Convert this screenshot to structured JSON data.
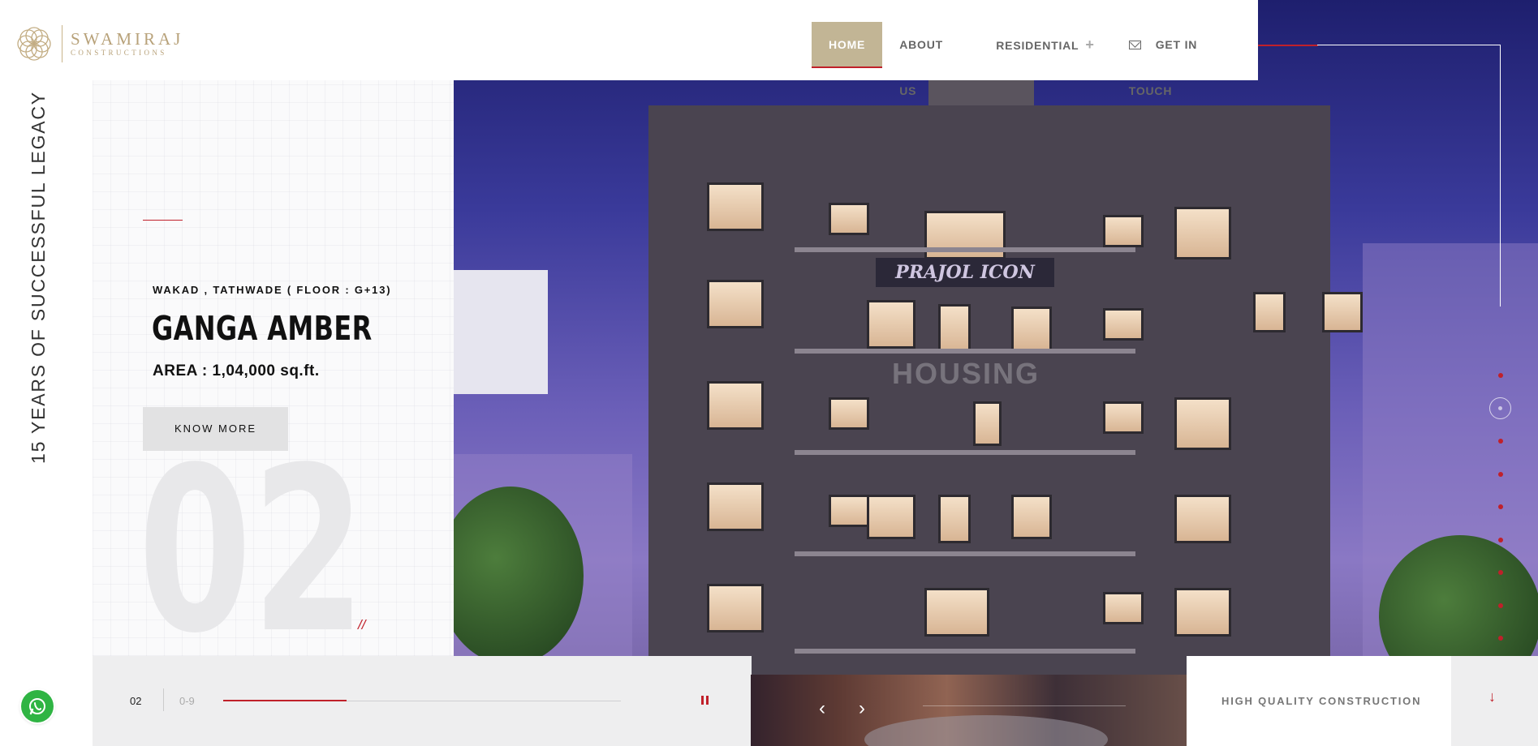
{
  "brand": {
    "name": "SWAMIRAJ",
    "tagline": "CONSTRUCTIONS"
  },
  "nav": {
    "items": [
      {
        "label": "HOME",
        "active": true
      },
      {
        "label": "ABOUT US"
      },
      {
        "label": "RESIDENTIAL"
      },
      {
        "label": "GET IN TOUCH"
      }
    ]
  },
  "side_text": "15 YEARS OF SUCCESSFUL LEGACY",
  "slide": {
    "location": "WAKAD , TATHWADE ( FLOOR : G+13)",
    "title": "GANGA AMBER",
    "area": "AREA : 1,04,000 sq.ft.",
    "cta": "KNOW MORE",
    "number": "02",
    "slashes": "//"
  },
  "hero_image": {
    "sign_text": "PRAJOL ICON",
    "watermark_text": "HOUSING"
  },
  "slider_controls": {
    "current": "02",
    "range": "0-9",
    "progress_fraction": 0.31
  },
  "bottom": {
    "feature_label": "HIGH QUALITY CONSTRUCTION",
    "scroll_icon": "arrow-down-icon"
  },
  "pagination": {
    "count": 9,
    "active_index": 1
  },
  "colors": {
    "accent": "#c0202a",
    "gold": "#c2b595",
    "whatsapp": "#2fb443"
  }
}
